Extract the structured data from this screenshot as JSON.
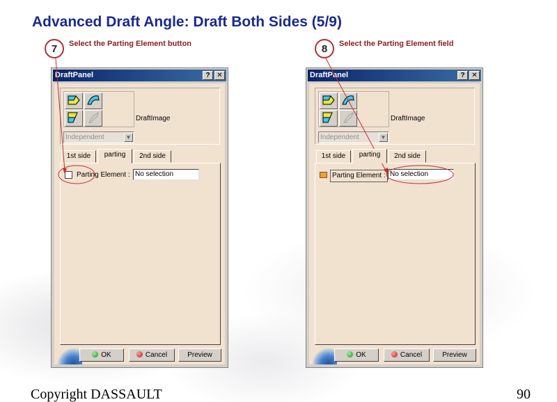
{
  "slide": {
    "title": "Advanced Draft Angle: Draft Both Sides (5/9)",
    "copyright": "Copyright DASSAULT",
    "page_number": "90"
  },
  "steps": [
    {
      "number": "7",
      "text": "Select the Parting Element button"
    },
    {
      "number": "8",
      "text": "Select the Parting Element field"
    }
  ],
  "panels": [
    {
      "window_title": "DraftPanel",
      "help_button": "?",
      "close_button": "✕",
      "image_label": "DraftImage",
      "combo_value": "Independent",
      "tabs": [
        "1st side",
        "parting",
        "2nd side"
      ],
      "active_tab": "parting",
      "parting_element_label": "Parting Element :",
      "parting_element_value": "No selection",
      "buttons": {
        "ok": "OK",
        "cancel": "Cancel",
        "preview": "Preview"
      }
    },
    {
      "window_title": "DraftPanel",
      "help_button": "?",
      "close_button": "✕",
      "image_label": "DraftImage",
      "combo_value": "Independent",
      "tabs": [
        "1st side",
        "parting",
        "2nd side"
      ],
      "active_tab": "parting",
      "parting_element_label": "Parting Element :",
      "parting_element_value": "No selection",
      "buttons": {
        "ok": "OK",
        "cancel": "Cancel",
        "preview": "Preview"
      }
    }
  ],
  "colors": {
    "title": "#1a2a8c",
    "annotation": "#8a2020",
    "panel_body": "#f1e1cf",
    "titlebar": "#0a246a"
  },
  "icons": [
    "draft-face-icon",
    "draft-reflect-icon",
    "draft-variable-icon",
    "draft-surface-icon",
    "chevron-down-icon",
    "help-icon",
    "close-icon",
    "ok-icon",
    "cancel-icon"
  ]
}
